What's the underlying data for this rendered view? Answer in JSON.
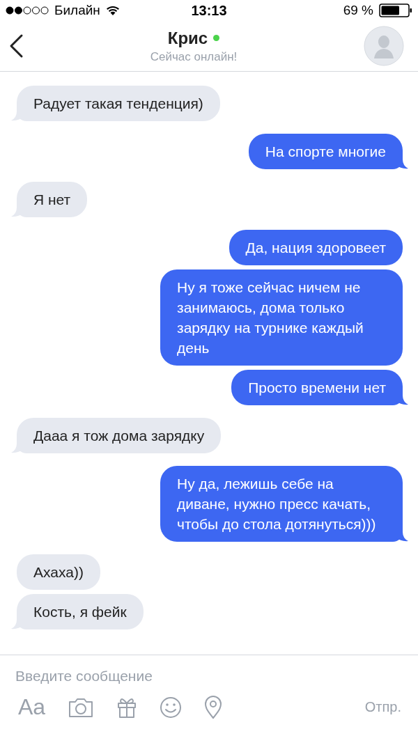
{
  "status_bar": {
    "carrier": "Билайн",
    "time": "13:13",
    "battery": "69 %"
  },
  "header": {
    "name": "Крис",
    "online": true,
    "status": "Сейчас онлайн!"
  },
  "messages": [
    {
      "kind": "incoming",
      "text": "Радует такая тенденция)",
      "tail": true
    },
    {
      "kind": "outgoing",
      "text": "На спорте многие",
      "tail": true
    },
    {
      "kind": "incoming",
      "text": "Я нет",
      "tail": true
    },
    {
      "kind": "outgoing",
      "text": "Да, нация здоровеет",
      "tail": false
    },
    {
      "kind": "outgoing",
      "text": "Ну я тоже сейчас ничем не занимаюсь, дома только зарядку на турнике каждый день",
      "tail": false
    },
    {
      "kind": "outgoing",
      "text": "Просто времени нет",
      "tail": true
    },
    {
      "kind": "incoming",
      "text": "Дааа я тож дома зарядку",
      "tail": true
    },
    {
      "kind": "outgoing",
      "text": "Ну да, лежишь себе на диване, нужно пресс качать, чтобы до стола дотянуться)))",
      "tail": true
    },
    {
      "kind": "incoming",
      "text": "Ахаха))",
      "tail": false
    },
    {
      "kind": "incoming",
      "text": "Кость, я фейк",
      "tail": true
    }
  ],
  "composer": {
    "placeholder": "Введите сообщение",
    "format_key": "Aa",
    "send": "Отпр."
  }
}
